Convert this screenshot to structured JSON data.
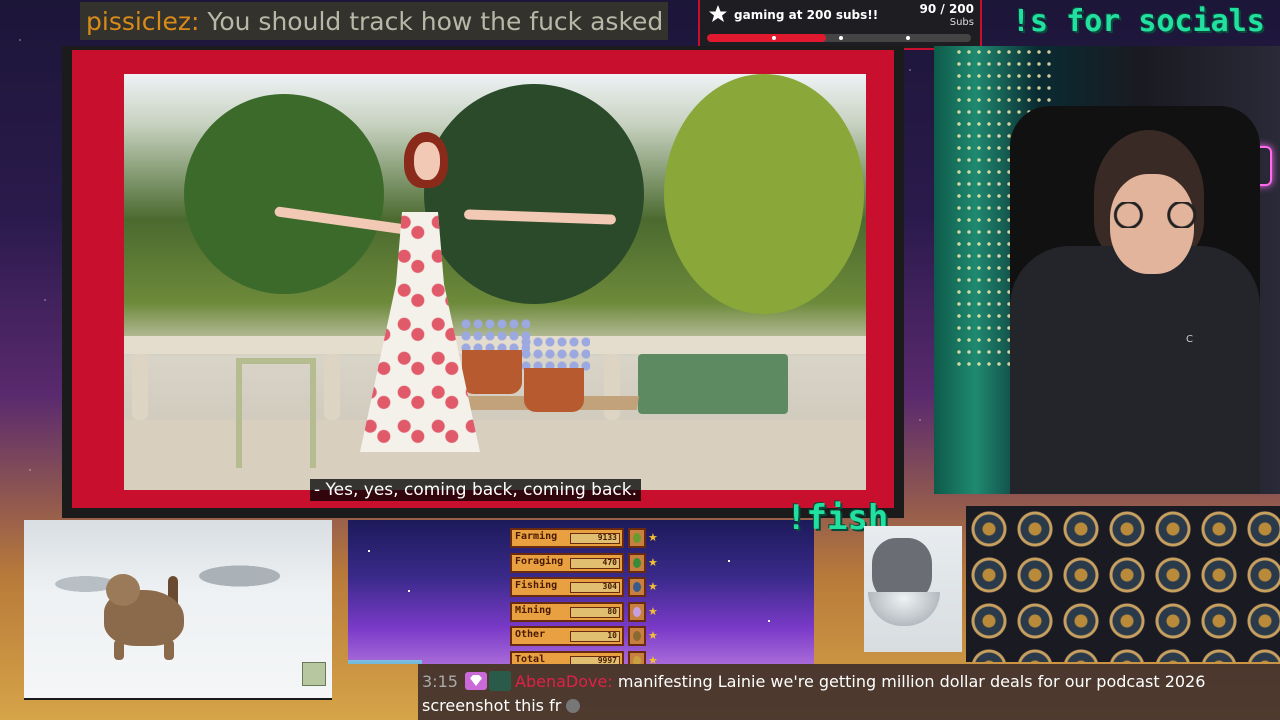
{
  "top_chat": {
    "username": "pissiclez:",
    "message": "You should track how the fuck asked"
  },
  "sub_goal": {
    "title": "gaming at 200 subs!!",
    "count": "90 / 200",
    "unit": "Subs",
    "progress": 0.45,
    "bar_color": "#e0192e"
  },
  "socials_command": "!s for socials :)",
  "main_video": {
    "subtitle": "- Yes, yes, coming back, coming back.",
    "frame_color": "#c8102e"
  },
  "webcam": {
    "hoodie_logo": "C"
  },
  "fish_command": "!fish",
  "stardew_skills": [
    {
      "name": "Farming",
      "value": "9133",
      "icon_color": "#6a9a30"
    },
    {
      "name": "Foraging",
      "value": "470",
      "icon_color": "#3a8a3a"
    },
    {
      "name": "Fishing",
      "value": "304",
      "icon_color": "#3a5a8a"
    },
    {
      "name": "Mining",
      "value": "80",
      "icon_color": "#c8a0e0"
    },
    {
      "name": "Other",
      "value": "10",
      "icon_color": "#8a6a30"
    },
    {
      "name": "Total",
      "value": "9997",
      "icon_color": "#c8a040"
    }
  ],
  "bottom_chat": {
    "time": "3:15",
    "username": "AbenaDove:",
    "message": "manifesting Lainie we're getting million dollar deals for our podcast 2026 screenshot this fr"
  }
}
